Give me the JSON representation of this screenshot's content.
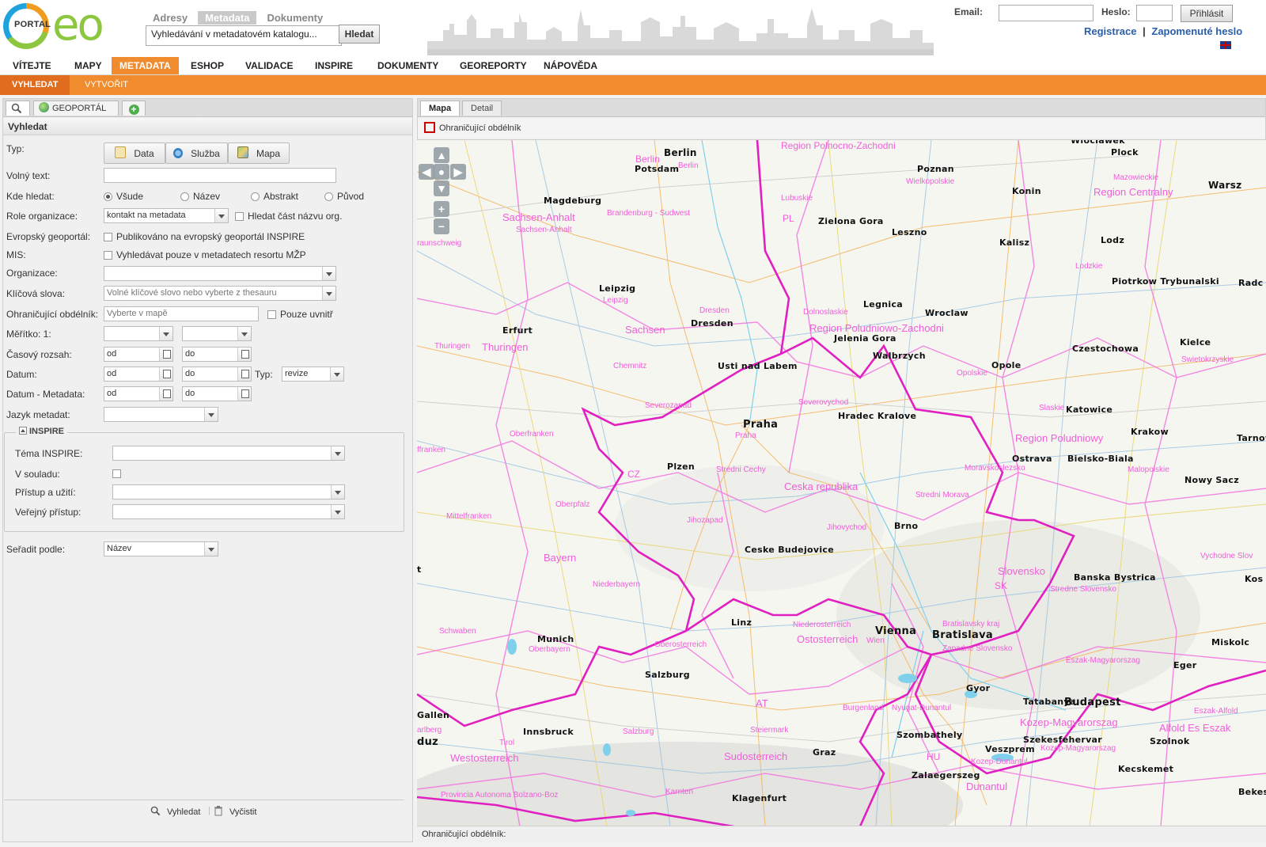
{
  "header": {
    "logo_text": "PORTAL",
    "logo_brand": "eo",
    "tabs": [
      "Adresy",
      "Metadata",
      "Dokumenty"
    ],
    "search_value": "Vyhledávání v metadatovém katalogu...",
    "search_button": "Hledat",
    "email_label": "Email:",
    "password_label": "Heslo:",
    "login_button": "Přihlásit",
    "register_link": "Registrace",
    "separator": "|",
    "forgot_link": "Zapomenuté heslo"
  },
  "mainnav": [
    "VÍTEJTE",
    "MAPY",
    "METADATA",
    "ESHOP",
    "VALIDACE",
    "INSPIRE",
    "DOKUMENTY",
    "GEOREPORTY",
    "NÁPOVĚDA"
  ],
  "subnav": [
    "VYHLEDAT",
    "VYTVOŘIT"
  ],
  "left": {
    "tab_geoportal": "GEOPORTÁL ČR",
    "panel_title": "Vyhledat",
    "labels": {
      "typ": "Typ:",
      "volny": "Volný text:",
      "kde": "Kde hledat:",
      "role": "Role organizace:",
      "evropsky": "Evropský geoportál:",
      "mis": "MIS:",
      "organizace": "Organizace:",
      "klicova": "Klíčová slova:",
      "ohran": "Ohraničující obdélník:",
      "meritko": "Měřítko: 1:",
      "casovy": "Časový rozsah:",
      "datum": "Datum:",
      "datum_meta": "Datum - Metadata:",
      "jazyk": "Jazyk metadat:",
      "typ2": "Typ:",
      "seradit": "Seřadit podle:"
    },
    "type_buttons": [
      "Data",
      "Služba",
      "Mapa"
    ],
    "radios": [
      "Všude",
      "Název",
      "Abstrakt",
      "Původ"
    ],
    "role_value": "kontakt na metadata",
    "hledat_cast": "Hledat část názvu org.",
    "evropsky_check": "Publikováno na evropský geoportál INSPIRE",
    "mis_check": "Vyhledávat pouze v metadatech resortu MŽP",
    "klicova_placeholder": "Volné klíčové slovo nebo vyberte z thesauru",
    "ohran_placeholder": "Vyberte v mapě",
    "pouze_uvnitr": "Pouze uvnitř",
    "od": "od",
    "do": "do",
    "typ_value": "revize",
    "inspire": {
      "legend": "INSPIRE",
      "tema": "Téma INSPIRE:",
      "soulad": "V souladu:",
      "pristup": "Přístup a užití:",
      "verejny": "Veřejný přístup:"
    },
    "seradit_value": "Název",
    "search_btn": "Vyhledat",
    "clear_btn": "Vyčistit"
  },
  "right": {
    "tabs": [
      "Mapa",
      "Detail"
    ],
    "tool": "Ohraničující obdélník",
    "status": "Ohraničující obdélník:"
  },
  "map": {
    "cities": [
      "Berlin",
      "Potsdam",
      "Poznan",
      "Wloclawek",
      "Plock",
      "Warsz",
      "Konin",
      "Magdeburg",
      "Zielona Gora",
      "Leszno",
      "Kalisz",
      "Lodz",
      "Leipzig",
      "Legnica",
      "Wroclaw",
      "Piotrkow Trybunalski",
      "Radc",
      "Dresden",
      "Erfurt",
      "Jelenia Gora",
      "Walbrzych",
      "Czestochowa",
      "Kielce",
      "Usti nad Labem",
      "Opole",
      "Katowice",
      "Krakow",
      "Tarnow",
      "Hradec Kralove",
      "Praha",
      "Ostrava",
      "Bielsko-Biala",
      "Plzen",
      "Nowy Sacz",
      "Brno",
      "Ceske Budejovice",
      "Banska Bystrica",
      "Kos",
      "Linz",
      "Vienna",
      "Bratislava",
      "Miskolc",
      "Munich",
      "Salzburg",
      "Eger",
      "Gyor",
      "Tatabanya",
      "Budapest",
      "Gallen",
      "Innsbruck",
      "Szombathely",
      "Szolnok",
      "Veszprem",
      "Szekesfehervar",
      "duz",
      "Graz",
      "Zalaegerszeg",
      "Kecskemet",
      "Klagenfurt",
      "Bekes",
      "t"
    ],
    "regions": [
      "Region Polnocno-Zachodni",
      "Berlin",
      "Berlin",
      "Wielkopolskie",
      "Mazowieckie",
      "Region Centralny",
      "Lubuskie",
      "Brandenburg - Sudwest",
      "Sachsen-Anhalt",
      "Sachsen-Anhalt",
      "PL",
      "Lodzkie",
      "raunschweig",
      "Leipzig",
      "Dolnoslaskie",
      "Dresden",
      "Region Poludniowo-Zachodni",
      "Sachsen",
      "Thuringen",
      "Thuringen",
      "Chemnitz",
      "Opolskie",
      "Swietokrzyskie",
      "Severovychod",
      "Severozapad",
      "Slaskie",
      "Region Poludniowy",
      "Oberfranken",
      "Moravskoslezsko",
      "Malopolskie",
      "ffranken",
      "Praha",
      "Stredni Cechy",
      "Ceska republika",
      "CZ",
      "Stredni Morava",
      "Oberpfalz",
      "Mittelfranken",
      "Jihozapad",
      "Jihovychod",
      "Bayern",
      "Slovensko",
      "Vychodne Slov",
      "SK",
      "Niederbayern",
      "Stredne Slovensko",
      "Bratislavsky kraj",
      "Niederosterreich",
      "Ostosterreich",
      "Wien",
      "Schwaben",
      "Oberbayern",
      "Oberosterreich",
      "Zapadne Slovensko",
      "Eszak-Magyarorszag",
      "AT",
      "Eszak-Alfold",
      "Burgenland",
      "Nyugat-Dunantul",
      "Kozep-Magyarorszag",
      "Alfold Es Eszak",
      "Kozep-Magyarorszag",
      "Tirol",
      "Salzburg",
      "Steiermark",
      "Westosterreich",
      "Sudosterreich",
      "HU",
      "Kozep-Dunantul",
      "Dunantul",
      "Provincia Autonoma Bolzano-Boz",
      "Karnten",
      "arlberg"
    ]
  },
  "colors": {
    "accent": "#f08c2e",
    "border_country": "#e020c0",
    "border_region": "#f070e0"
  }
}
